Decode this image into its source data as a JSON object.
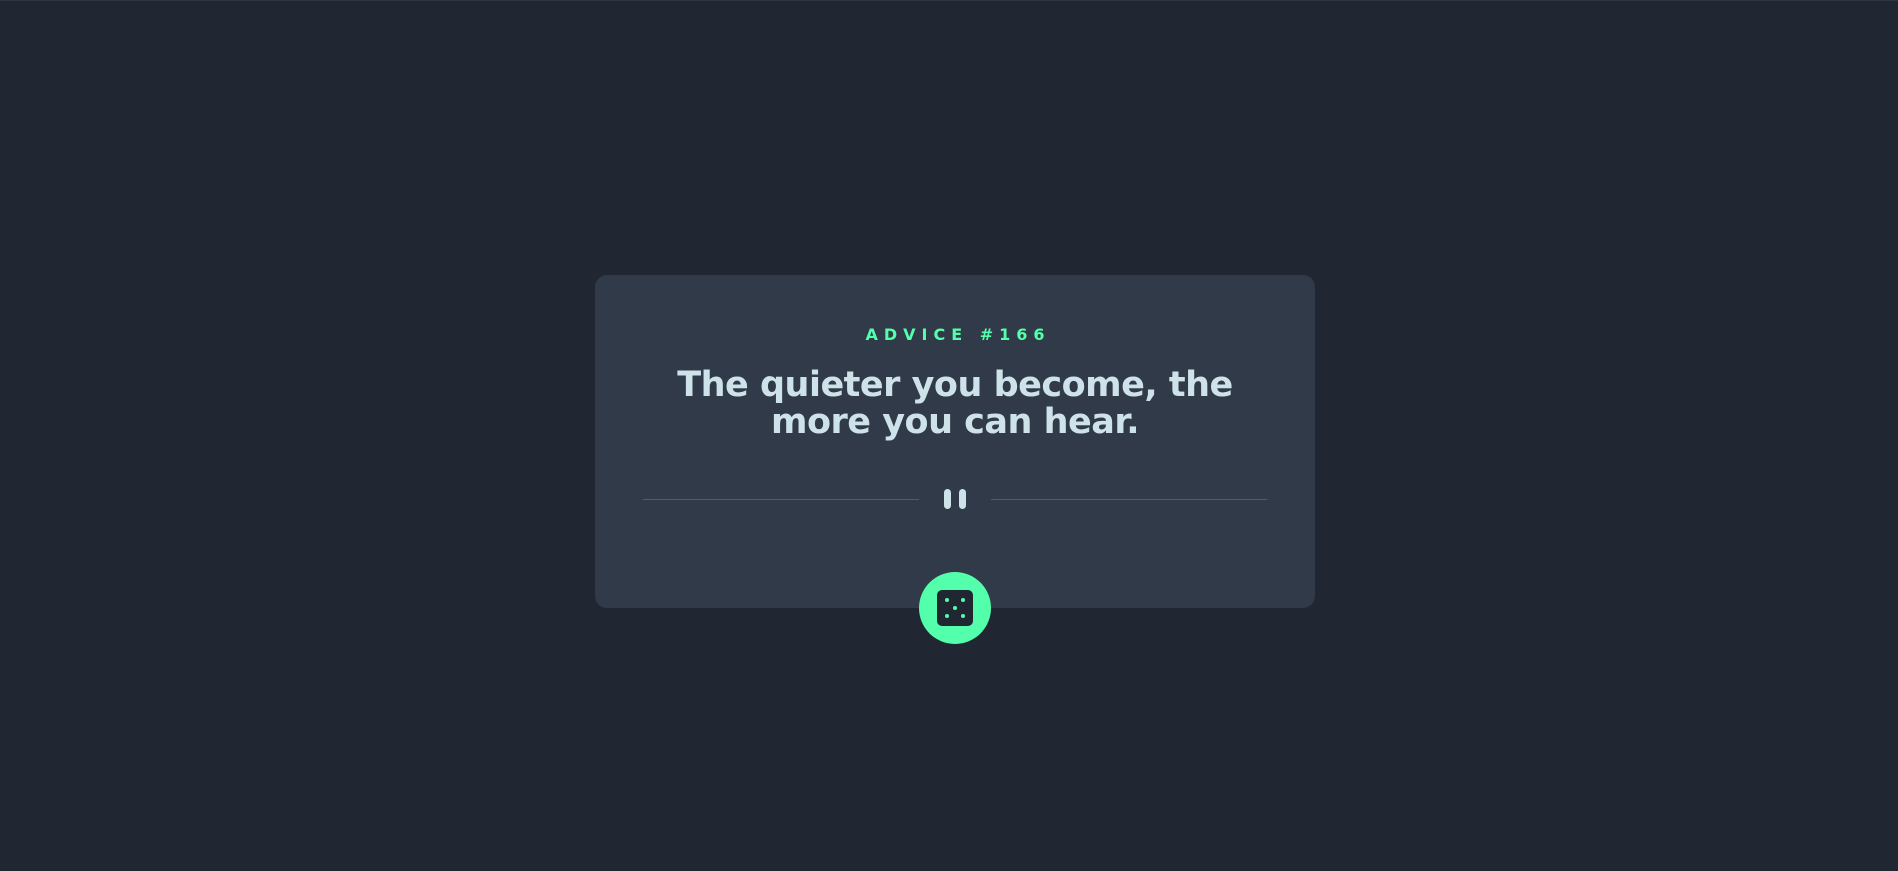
{
  "advice": {
    "label": "ADVICE #166",
    "text": "The quieter you become, the more you can hear."
  },
  "icons": {
    "divider": "pause-icon",
    "button": "dice-icon"
  },
  "colors": {
    "background": "#202733",
    "card": "#313a48",
    "accent": "#53ffab",
    "text": "#cee3e9",
    "divider": "#4f5d74"
  }
}
